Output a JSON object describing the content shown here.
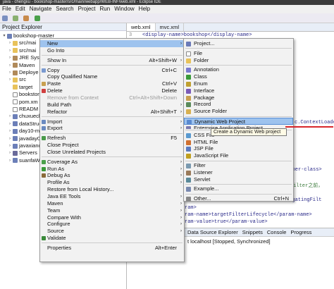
{
  "window": {
    "title": "java - chengxu - bookshop-master/src/main/webapp/WEB-INF/web.xml - Eclipse IDE"
  },
  "menubar": [
    "File",
    "Edit",
    "Navigate",
    "Search",
    "Project",
    "Run",
    "Window",
    "Help"
  ],
  "explorer": {
    "title": "Project Explorer",
    "items": [
      {
        "label": "bookshop-master",
        "twisty": "▾",
        "icon": "project-icon"
      },
      {
        "label": "src/mai",
        "twisty": "›",
        "icon": "folder-icon"
      },
      {
        "label": "src/mai",
        "twisty": "›",
        "icon": "folder-icon"
      },
      {
        "label": "JRE Syst",
        "twisty": "›",
        "icon": "library-icon"
      },
      {
        "label": "Maven",
        "twisty": "›",
        "icon": "library-icon"
      },
      {
        "label": "Deploye",
        "twisty": "›",
        "icon": "library-icon"
      },
      {
        "label": "src",
        "twisty": "›",
        "icon": "folder-icon"
      },
      {
        "label": "target",
        "twisty": "",
        "icon": "folder-icon"
      },
      {
        "label": "bookstor",
        "twisty": "",
        "icon": "file-icon"
      },
      {
        "label": "pom.xm",
        "twisty": "",
        "icon": "file-icon"
      },
      {
        "label": "READM",
        "twisty": "",
        "icon": "file-icon"
      },
      {
        "label": "chuxueche",
        "twisty": "›",
        "icon": "project-icon"
      },
      {
        "label": "dataStruct",
        "twisty": "›",
        "icon": "project-icon"
      },
      {
        "label": "day10-mo",
        "twisty": "›",
        "icon": "project-icon"
      },
      {
        "label": "javaday09",
        "twisty": "›",
        "icon": "project-icon"
      },
      {
        "label": "javaxianch",
        "twisty": "›",
        "icon": "project-icon"
      },
      {
        "label": "Servers",
        "twisty": "›",
        "icon": "server-icon"
      },
      {
        "label": "suanfaWe",
        "twisty": "›",
        "icon": "project-icon"
      }
    ]
  },
  "editor": {
    "tabs": [
      "web.xml",
      "mvc.xml"
    ],
    "line1_num": "3",
    "line1": "<display-name>bookshop</display-name>",
    "fragments": [
      "c.ContextLoade",
      "stener-class>",
      "再filter之前，",
      "legatingFilt",
      "ram>",
      "ram-name>targetFilterLifecycle</param-name>",
      "ram-value>true</param-value>"
    ]
  },
  "bottom": {
    "tabs": [
      "Data Source Explorer",
      "Snippets",
      "Console",
      "Progress"
    ],
    "status": "t localhost  [Stopped, Synchronized]"
  },
  "context_menu": [
    {
      "label": "New",
      "arrow": "›",
      "hl": true
    },
    {
      "label": "Go Into"
    },
    {
      "sep": true
    },
    {
      "label": "Show In",
      "shortcut": "Alt+Shift+W",
      "arrow": "›"
    },
    {
      "sep": true
    },
    {
      "label": "Copy",
      "shortcut": "Ctrl+C",
      "icon": "copy-icon"
    },
    {
      "label": "Copy Qualified Name"
    },
    {
      "label": "Paste",
      "shortcut": "Ctrl+V",
      "icon": "paste-icon"
    },
    {
      "label": "Delete",
      "shortcut": "Delete",
      "icon": "delete-icon"
    },
    {
      "label": "Remove from Context",
      "shortcut": "Ctrl+Alt+Shift+Down",
      "disabled": true
    },
    {
      "label": "Build Path",
      "arrow": "›"
    },
    {
      "label": "Refactor",
      "shortcut": "Alt+Shift+T",
      "arrow": "›"
    },
    {
      "sep": true
    },
    {
      "label": "Import",
      "arrow": "›",
      "icon": "import-icon"
    },
    {
      "label": "Export",
      "arrow": "›",
      "icon": "export-icon"
    },
    {
      "sep": true
    },
    {
      "label": "Refresh",
      "shortcut": "F5",
      "icon": "refresh-icon"
    },
    {
      "label": "Close Project"
    },
    {
      "label": "Close Unrelated Projects"
    },
    {
      "sep": true
    },
    {
      "label": "Coverage As",
      "arrow": "›",
      "icon": "coverage-icon"
    },
    {
      "label": "Run As",
      "arrow": "›",
      "icon": "run-icon"
    },
    {
      "label": "Debug As",
      "arrow": "›",
      "icon": "debug-icon"
    },
    {
      "label": "Profile As",
      "arrow": "›"
    },
    {
      "label": "Restore from Local History..."
    },
    {
      "label": "Java EE Tools",
      "arrow": "›"
    },
    {
      "label": "Maven",
      "arrow": "›"
    },
    {
      "label": "Team",
      "arrow": "›"
    },
    {
      "label": "Compare With",
      "arrow": "›"
    },
    {
      "label": "Configure",
      "arrow": "›"
    },
    {
      "label": "Source",
      "arrow": "›"
    },
    {
      "label": "Validate",
      "icon": "check-icon"
    },
    {
      "sep": true
    },
    {
      "label": "Properties",
      "shortcut": "Alt+Enter"
    }
  ],
  "submenu": [
    {
      "label": "Project...",
      "icon": "project-wizard-icon"
    },
    {
      "sep": true
    },
    {
      "label": "File",
      "icon": "file-icon"
    },
    {
      "label": "Folder",
      "icon": "folder-icon"
    },
    {
      "sep": true
    },
    {
      "label": "Annotation",
      "icon": "annotation-icon"
    },
    {
      "label": "Class",
      "icon": "class-icon"
    },
    {
      "label": "Enum",
      "icon": "enum-icon"
    },
    {
      "label": "Interface",
      "icon": "interface-icon"
    },
    {
      "label": "Package",
      "icon": "package-icon"
    },
    {
      "label": "Record",
      "icon": "record-icon"
    },
    {
      "label": "Source Folder",
      "icon": "source-folder-icon"
    },
    {
      "sep": true
    },
    {
      "label": "Dynamic Web Project",
      "icon": "web-project-icon",
      "hl": true
    },
    {
      "label": "Enterprise Application Project",
      "icon": "ear-icon",
      "partial": true
    },
    {
      "sep": true
    },
    {
      "label": "CSS File",
      "icon": "css-icon"
    },
    {
      "label": "HTML File",
      "icon": "html-icon"
    },
    {
      "label": "JSP File",
      "icon": "jsp-icon"
    },
    {
      "label": "JavaScript File",
      "icon": "js-icon"
    },
    {
      "sep": true
    },
    {
      "label": "Filter",
      "icon": "filter-icon"
    },
    {
      "label": "Listener",
      "icon": "listener-icon"
    },
    {
      "label": "Servlet",
      "icon": "servlet-icon"
    },
    {
      "sep": true
    },
    {
      "label": "Example...",
      "icon": "example-icon"
    },
    {
      "sep": true
    },
    {
      "label": "Other...",
      "shortcut": "Ctrl+N",
      "icon": "other-icon"
    }
  ],
  "tooltip": "Create a Dynamic Web project",
  "colors": {
    "highlight": "#9ec3ee",
    "annotation_line": "#d8262b",
    "menu_bg": "#f2f2f2"
  }
}
